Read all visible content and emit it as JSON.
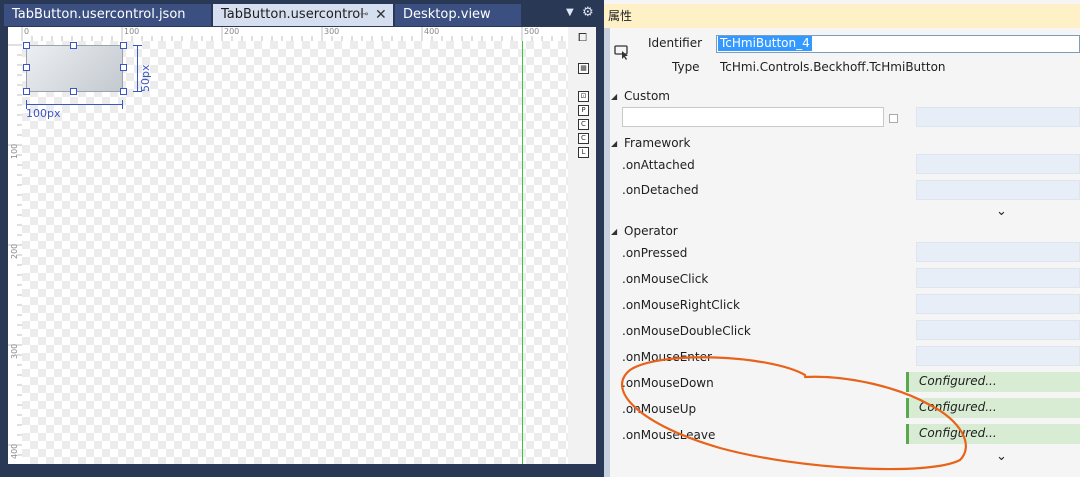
{
  "tabs": [
    {
      "label": "TabButton.usercontrol.json",
      "active": false
    },
    {
      "label": "TabButton.usercontrol",
      "active": true
    },
    {
      "label": "Desktop.view",
      "active": false
    }
  ],
  "tab_controls": {
    "pin_icon": "pin-icon",
    "close_icon": "close-icon",
    "dropdown_icon": "chevron-down-icon",
    "settings_icon": "gear-icon"
  },
  "ruler": {
    "top_ticks": [
      "0",
      "100",
      "200",
      "300",
      "400",
      "500"
    ],
    "left_ticks": [
      "100",
      "200",
      "300",
      "400"
    ]
  },
  "design": {
    "width_label": "100px",
    "height_label": "50px"
  },
  "toolbox_buttons": [
    "P",
    "C",
    "C",
    "L"
  ],
  "properties": {
    "title": "属性",
    "identifier_label": "Identifier",
    "identifier_value": "TcHmiButton_4",
    "type_label": "Type",
    "type_value": "TcHmi.Controls.Beckhoff.TcHmiButton",
    "categories": {
      "custom": "Custom",
      "framework": "Framework",
      "operator": "Operator"
    },
    "framework_events": [
      ".onAttached",
      ".onDetached"
    ],
    "operator_events": [
      {
        "label": ".onPressed",
        "value": ""
      },
      {
        "label": ".onMouseClick",
        "value": ""
      },
      {
        "label": ".onMouseRightClick",
        "value": ""
      },
      {
        "label": ".onMouseDoubleClick",
        "value": ""
      },
      {
        "label": ".onMouseEnter",
        "value": ""
      },
      {
        "label": ".onMouseDown",
        "value": "Configured..."
      },
      {
        "label": ".onMouseUp",
        "value": "Configured..."
      },
      {
        "label": ".onMouseLeave",
        "value": "Configured..."
      }
    ]
  },
  "colors": {
    "accent_annotation": "#e8621a",
    "configured_bg": "#d7ecd2",
    "configured_border": "#5aa84e",
    "guide_line": "#3cc43c",
    "selection": "#3a56c5"
  }
}
